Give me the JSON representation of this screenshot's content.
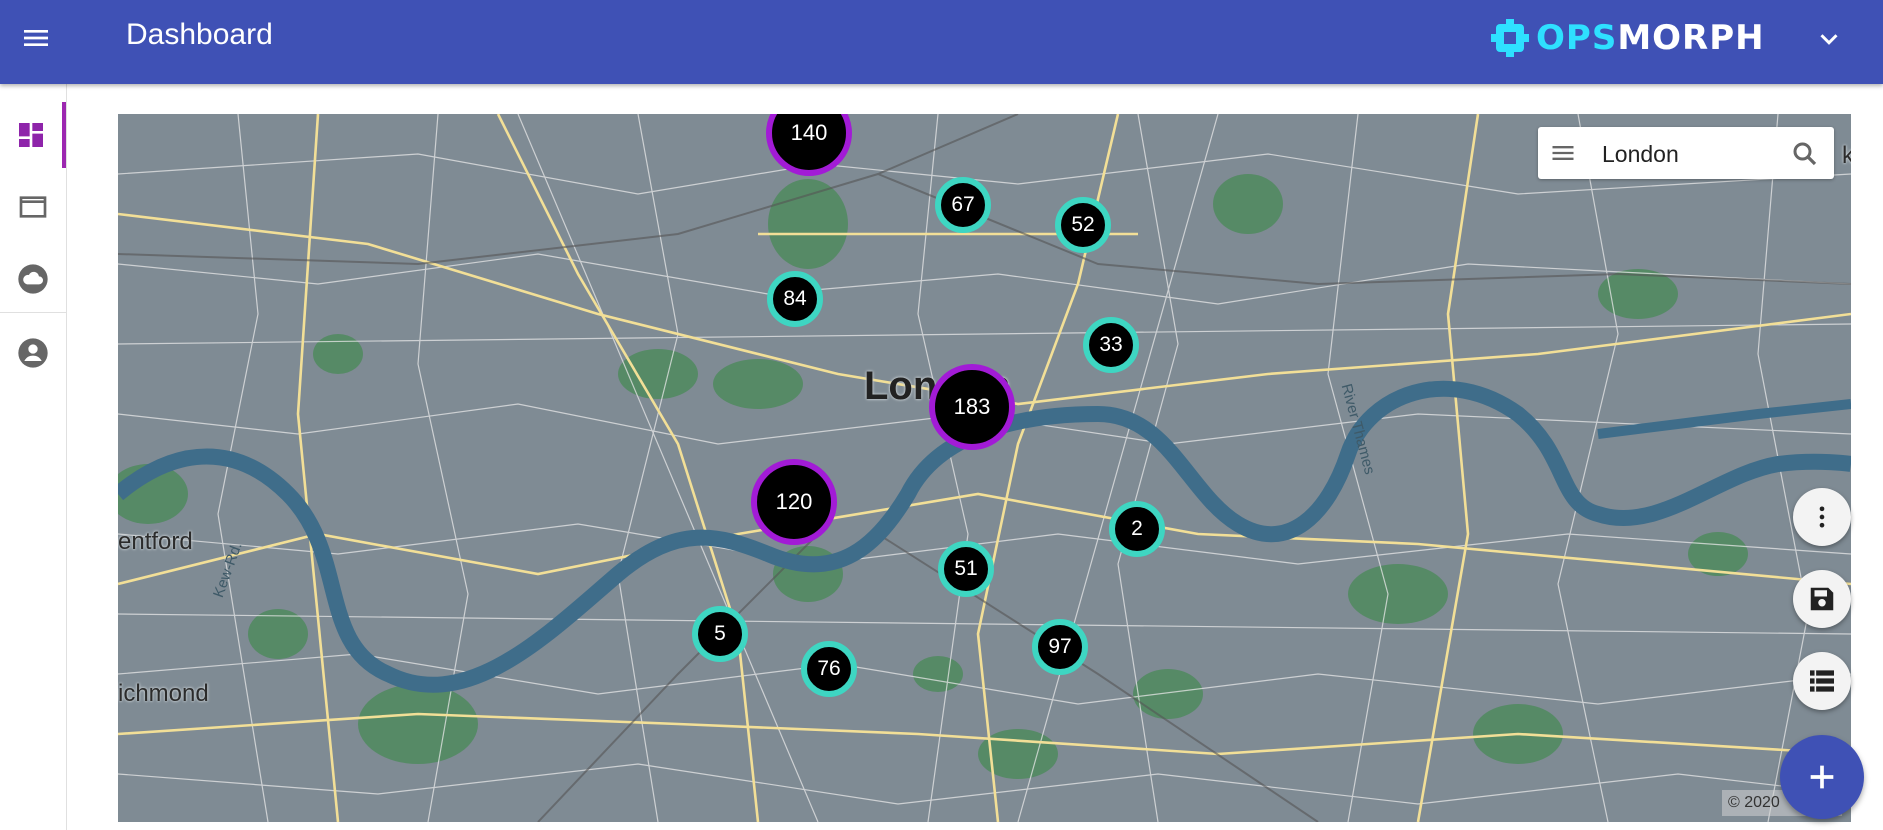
{
  "header": {
    "title": "Dashboard",
    "brand_ops": "OPS",
    "brand_morph": "MORPH"
  },
  "sidebar": {
    "items": [
      {
        "icon": "dashboard-icon",
        "active": true
      },
      {
        "icon": "window-icon",
        "active": false
      },
      {
        "icon": "cloud-icon",
        "active": false
      },
      {
        "icon": "account-icon",
        "active": false
      }
    ]
  },
  "map": {
    "search_value": "London",
    "labels": {
      "city": "London",
      "brentford": "entford",
      "richmond": "ichmond",
      "kew_road": "Kew-Rd.",
      "river": "River Thames",
      "edge_k": "k"
    },
    "attribution": "© 2020",
    "clusters": [
      {
        "count": "140",
        "size": "large"
      },
      {
        "count": "67",
        "size": "small"
      },
      {
        "count": "52",
        "size": "small"
      },
      {
        "count": "84",
        "size": "small"
      },
      {
        "count": "33",
        "size": "small"
      },
      {
        "count": "183",
        "size": "large"
      },
      {
        "count": "120",
        "size": "large"
      },
      {
        "count": "2",
        "size": "small"
      },
      {
        "count": "51",
        "size": "small"
      },
      {
        "count": "5",
        "size": "small"
      },
      {
        "count": "76",
        "size": "small"
      },
      {
        "count": "97",
        "size": "small"
      }
    ]
  },
  "colors": {
    "appbar": "#3f51b5",
    "accent_purple": "#9c27b0",
    "cluster_small_ring": "#3ed6c2",
    "cluster_large_ring": "#a21bd6",
    "brand_ops": "#2ee0ff"
  }
}
